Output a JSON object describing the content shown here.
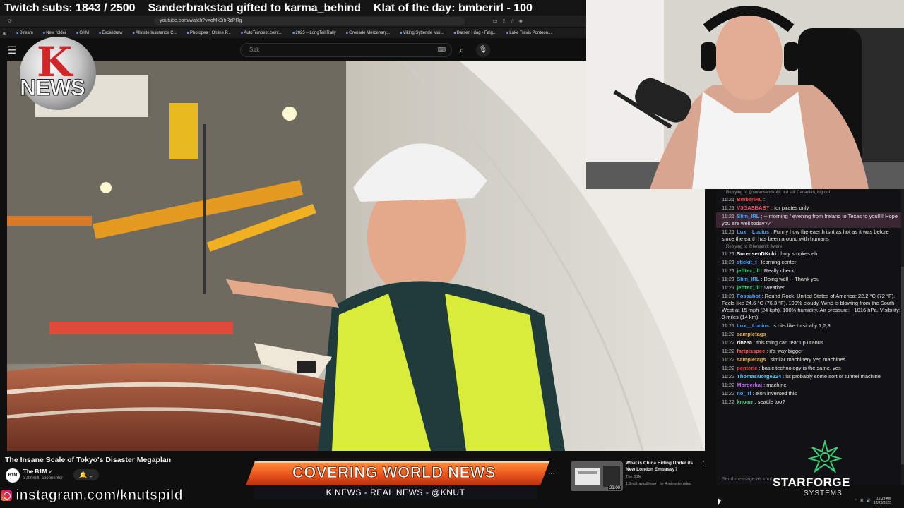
{
  "ticker": {
    "subs": "Twitch subs: 1843 / 2500",
    "gift": "Sanderbrakstad gifted to karma_behind",
    "klat": "Klat of the day: bmberirl - 100"
  },
  "browser": {
    "url": "youtube.com/watch?v=oMk3ihRzPRg",
    "bookmarks": [
      "Stream",
      "New folder",
      "GYM",
      "Excalidraw",
      "Allstate Insurance C...",
      "Photopea | Online P...",
      "AutoTempest.com:...",
      "2025 – LongTail Rally",
      "Grenade Mercenary...",
      "Viking Syttende Mai...",
      "Barsen i dag - Følg...",
      "Lake Travis Pontoon..."
    ]
  },
  "youtube": {
    "search_placeholder": "Søk",
    "video_title": "The Insane Scale of Tokyo's Disaster Megaplan",
    "channel_name": "The B1M",
    "channel_subs": "3,88 mill. abonnenter",
    "channel_avatar_text": "B1M",
    "suggested": {
      "title": "What is China Hiding Under its New London Embassy?",
      "channel": "The B1M",
      "meta": "1,3 mill. avspillinger · for 4 måneder siden",
      "duration": "21:00"
    }
  },
  "overlay": {
    "logo_text": "NEWS",
    "logo_letter": "K",
    "banner": "COVERING WORLD NEWS",
    "banner_sub": "K NEWS - REAL NEWS - @KNUT",
    "instagram": "instagram.com/knutspild",
    "starforge_title": "STARFORGE",
    "starforge_sub": "SYSTEMS"
  },
  "chat": {
    "input_placeholder": "Send message as knut",
    "messages": [
      {
        "reply_to": "Replying to @sorensendkuki: but still Canadian, big oof"
      },
      {
        "time": "11:21",
        "user": "BmberIRL",
        "color": "#ff3b3b",
        "text": ""
      },
      {
        "time": "11:21",
        "user": "V3GASBABY",
        "color": "#ff4d6d",
        "text": "for pirates only"
      },
      {
        "time": "11:21",
        "user": "Slim_IRL",
        "color": "#3fa8ff",
        "text": "-- morning / evening from Ireland to Texas to you!!!! Hope you are well today??",
        "highlight": true
      },
      {
        "time": "11:21",
        "user": "Lux__Lucius",
        "color": "#4aa3ff",
        "text": "Funny how the eaerth isnt as hot as it was before since the earth has been around with humans"
      },
      {
        "reply_to": "Replying to @bmberirl: Aware"
      },
      {
        "time": "11:21",
        "user": "SorensenDKuki",
        "color": "#ffffff",
        "text": "holy smokes eh"
      },
      {
        "time": "11:21",
        "user": "stickit_t",
        "color": "#4aa3ff",
        "text": "learning center"
      },
      {
        "time": "11:21",
        "user": "jefftex_ill",
        "color": "#3fd07a",
        "text": "Really check"
      },
      {
        "time": "11:21",
        "user": "Slim_IRL",
        "color": "#3fa8ff",
        "text": "Doing well -- Thank you"
      },
      {
        "time": "11:21",
        "user": "jefftex_ill",
        "color": "#3fd07a",
        "text": "!weather"
      },
      {
        "time": "11:21",
        "user": "Fossabot",
        "color": "#4aa3ff",
        "text": "Round Rock, United States of America: 22.2 °C (72 °F). Feels like 24.6 °C (76.3 °F). 100% cloudy. Wind is blowing from the South-West at 15 mph (24 kph). 100% humidity. Air pressure: ~1016 hPa. Visibility: 8 miles (14 km)."
      },
      {
        "time": "11:21",
        "user": "Lux__Lucius",
        "color": "#4aa3ff",
        "text": "s oits like basically 1,2,3"
      },
      {
        "time": "11:22",
        "user": "sampletags",
        "color": "#e0b050",
        "text": ""
      },
      {
        "time": "11:22",
        "user": "rinzea",
        "color": "#ffffff",
        "text": "this thing can tear up uranus"
      },
      {
        "time": "11:22",
        "user": "fartpisspee",
        "color": "#ff5a5a",
        "text": "it's way bigger"
      },
      {
        "time": "11:22",
        "user": "sampletags",
        "color": "#e0b050",
        "text": "similar machinery yep machines"
      },
      {
        "time": "11:22",
        "user": "penterie",
        "color": "#ff3b3b",
        "text": "basic technology is the same, yes"
      },
      {
        "time": "11:22",
        "user": "ThomasNorge224",
        "color": "#4ad0ff",
        "text": "its probably some sort of tunnel machine"
      },
      {
        "time": "11:22",
        "user": "Morderkaj",
        "color": "#c070ff",
        "text": "machine"
      },
      {
        "time": "11:22",
        "user": "no_irl",
        "color": "#4aa3ff",
        "text": "elon invented this"
      },
      {
        "time": "11:22",
        "user": "knoarr",
        "color": "#3fd07a",
        "text": "seattle too?"
      }
    ]
  },
  "taskbar": {
    "time": "11:23 AM",
    "date": "12/28/2025"
  }
}
